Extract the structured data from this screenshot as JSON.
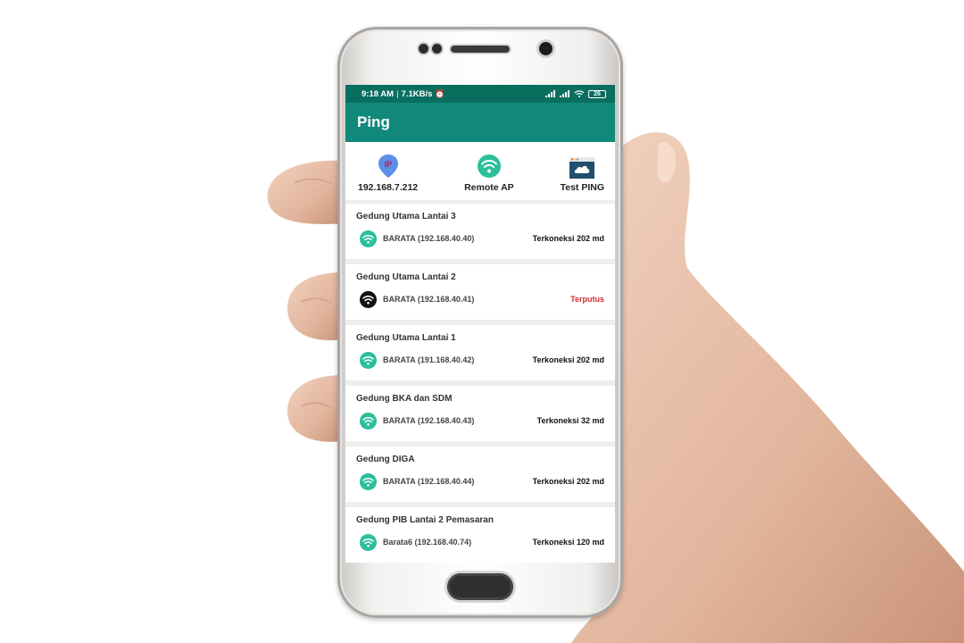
{
  "status_bar": {
    "time": "9:18 AM",
    "speed": "7.1KB/s",
    "battery": "26"
  },
  "app_bar": {
    "title": "Ping"
  },
  "actions": [
    {
      "label": "192.168.7.212",
      "icon": "ip-location-icon",
      "badge": "IP"
    },
    {
      "label": "Remote AP",
      "icon": "wifi-icon"
    },
    {
      "label": "Test PING",
      "icon": "cloud-icon"
    }
  ],
  "access_points": [
    {
      "location": "Gedung Utama Lantai 3",
      "ap": "BARATA (192.168.40.40)",
      "status": "Terkoneksi 202 md",
      "connected": true
    },
    {
      "location": "Gedung Utama Lantai 2",
      "ap": "BARATA (192.168.40.41)",
      "status": "Terputus",
      "connected": false
    },
    {
      "location": "Gedung Utama Lantai 1",
      "ap": "BARATA (191.168.40.42)",
      "status": "Terkoneksi 202 md",
      "connected": true
    },
    {
      "location": "Gedung BKA dan SDM",
      "ap": "BARATA (192.168.40.43)",
      "status": "Terkoneksi 32 md",
      "connected": true
    },
    {
      "location": "Gedung DIGA",
      "ap": "BARATA (192.168.40.44)",
      "status": "Terkoneksi 202 md",
      "connected": true
    },
    {
      "location": "Gedung PIB Lantai 2 Pemasaran",
      "ap": "Barata6 (192.168.40.74)",
      "status": "Terkoneksi 120 md",
      "connected": true
    }
  ],
  "colors": {
    "status_bar": "#0a6e5f",
    "app_bar": "#10897a",
    "connected_icon": "#2bbf9a",
    "disconnected_icon": "#111111",
    "disconnected_text": "#d32f2f"
  }
}
